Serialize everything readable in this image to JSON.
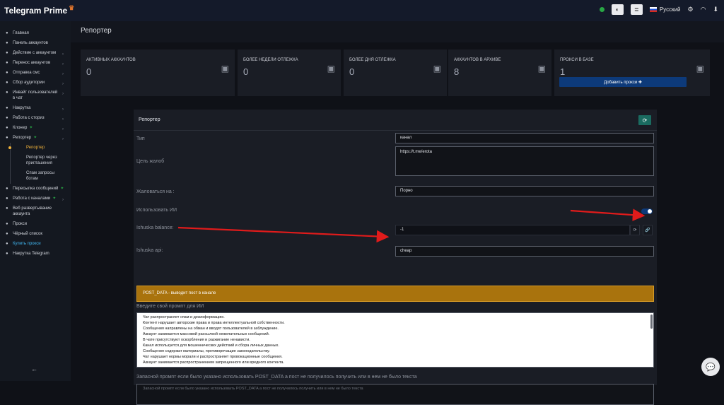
{
  "app": {
    "name": "Telegram Prime"
  },
  "topbar": {
    "language": "Русский"
  },
  "sidebar": {
    "items": [
      {
        "label": "Главная",
        "icon": "gauge-icon"
      },
      {
        "label": "Панель аккаунтов",
        "icon": "users-icon"
      },
      {
        "label": "Действие с аккаунтом",
        "icon": "user-gear-icon",
        "chevron": true
      },
      {
        "label": "Перенос аккаунтов",
        "icon": "transfer-icon",
        "chevron": true
      },
      {
        "label": "Отправка смс",
        "icon": "sms-icon",
        "chevron": true
      },
      {
        "label": "Сбор аудитории",
        "icon": "target-icon",
        "chevron": true
      },
      {
        "label": "Инвайт пользователей в чат",
        "icon": "invite-icon",
        "chevron": true
      },
      {
        "label": "Накрутка",
        "icon": "boost-icon",
        "chevron": true
      },
      {
        "label": "Работа с сториз",
        "icon": "story-icon",
        "chevron": true
      },
      {
        "label": "Клонер",
        "icon": "clone-icon",
        "chevron": true,
        "new": true
      },
      {
        "label": "Репортер",
        "icon": "report-icon",
        "chevron": true,
        "new": true
      }
    ],
    "sub_items": [
      {
        "label": "Репортер",
        "active": true
      },
      {
        "label": "Репортер через приглашения"
      },
      {
        "label": "Спам запросы ботам"
      }
    ],
    "items2": [
      {
        "label": "Пересылка сообщений",
        "icon": "forward-icon",
        "new": true
      },
      {
        "label": "Работа с каналами",
        "icon": "channel-icon",
        "chevron": true,
        "new": true
      },
      {
        "label": "Веб развертывание аккаунта",
        "icon": "web-icon"
      },
      {
        "label": "Прокси",
        "icon": "wifi-icon"
      },
      {
        "label": "Чёрный список",
        "icon": "x-icon"
      },
      {
        "label": "Купить прокси",
        "icon": "cart-icon",
        "link": true
      },
      {
        "label": "Накрутка Telegram",
        "icon": "telegram-icon"
      }
    ]
  },
  "page": {
    "title": "Репортер"
  },
  "stats": [
    {
      "label": "АКТИВНЫХ АККАУНТОВ",
      "value": "0",
      "icon": "user-icon"
    },
    {
      "label": "БОЛЕЕ НЕДЕЛИ ОТЛЕЖКА",
      "value": "0",
      "icon": "calendar-check-icon"
    },
    {
      "label": "БОЛЕЕ ДНЯ ОТЛЕЖКА",
      "value": "0",
      "icon": "calendar-icon"
    },
    {
      "label": "АККАУНТОВ В АРХИВЕ",
      "value": "8",
      "icon": "archive-file-icon"
    },
    {
      "label": "ПРОКСИ В БАЗЕ",
      "value": "1",
      "icon": "wifi-icon",
      "button": "Добавить прокси ✚"
    }
  ],
  "form": {
    "title": "Репортер",
    "type_label": "Тип",
    "type_value": "канал",
    "target_label": "Цель жалоб",
    "target_value": "https://t.me/erota",
    "complain_label": "Жаловаться на :",
    "complain_value": "Порно",
    "ai_label": "Использовать ИИ",
    "ai_enabled": true,
    "balance_label": "Ishuska balance:",
    "balance_value": "-1",
    "api_label": "Ishuska api:",
    "api_value": "cheap",
    "warning": "POST_DATA - выводит пост в канале",
    "prompt_label": "Введите свой промпт для ИИ",
    "prompt_lines": [
      "Чат распространяет спам и дезинформацию.",
      "Контент нарушает авторские права и права интеллектуальной собственности.",
      "Сообщения направлены на обман и вводят пользователей в заблуждение.",
      "Аккаунт занимается массовой рассылкой нежелательных сообщений.",
      "В чате присутствуют оскорбления и разжигание ненависти.",
      "Канал используется для мошеннических действий и сбора личных данных.",
      "Сообщения содержат материалы, противоречащие законодательству.",
      "Чат нарушает нормы морали и распространяет провокационные сообщения.",
      "Аккаунт занимается распространением запрещенного или вредного контента."
    ],
    "fallback_label": "Запасной промпт если было указано использовать POST_DATA а пост не получилось получить или в нем не было текста",
    "fallback_placeholder": "Запасной промпт если было указано использовать POST_DATA а пост не получилось получить или в нем не было текста"
  },
  "colors": {
    "accent": "#0d3a7a",
    "warning": "#a9730d",
    "active": "#f0b23a",
    "arrow": "#e01b1b"
  }
}
